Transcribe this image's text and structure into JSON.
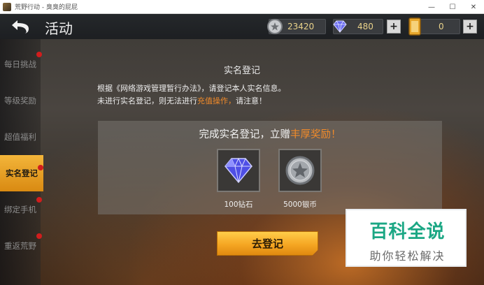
{
  "window": {
    "title": "荒野行动 - 臭臭的屁屁",
    "minimize": "—",
    "maximize": "☐",
    "close": "✕"
  },
  "topbar": {
    "title": "活动",
    "silver": "23420",
    "diamonds": "480",
    "tickets": "0",
    "plus": "+"
  },
  "sidebar": {
    "items": [
      {
        "label": "每日挑战",
        "badge": true
      },
      {
        "label": "等级奖励",
        "badge": false
      },
      {
        "label": "超值福利",
        "badge": false
      },
      {
        "label": "实名登记",
        "badge": true
      },
      {
        "label": "绑定手机",
        "badge": true
      },
      {
        "label": "重返荒野",
        "badge": true
      }
    ]
  },
  "content": {
    "heading": "实名登记",
    "line1": "根据《网络游戏管理暂行办法》，请登记本人实名信息。",
    "line2_a": "未进行实名登记，则无法进行",
    "line2_hl": "充值操作，",
    "line2_b": "请注意！",
    "reward_title_a": "完成实名登记，立赠",
    "reward_title_hl": "丰厚奖励！",
    "rewards": [
      {
        "label": "100钻石",
        "icon": "diamond-icon"
      },
      {
        "label": "5000银币",
        "icon": "silver-coin-icon"
      }
    ],
    "register_button": "去登记"
  },
  "watermark": {
    "main": "百科全说",
    "sub": "助你轻松解决"
  },
  "colors": {
    "accent": "#f5a623",
    "highlight": "#f08a2a",
    "watermark": "#1ba784"
  }
}
